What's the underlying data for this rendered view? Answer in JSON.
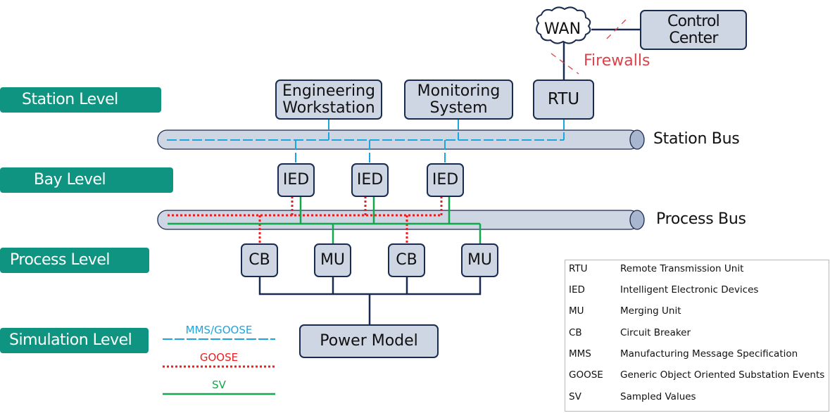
{
  "levels": [
    {
      "label": "Station Level"
    },
    {
      "label": "Bay Level"
    },
    {
      "label": "Process Level"
    },
    {
      "label": "Simulation Level"
    }
  ],
  "nodes": {
    "wan": "WAN",
    "control_center": "Control Center",
    "firewalls": "Firewalls",
    "engineering_workstation": "Engineering Workstation",
    "monitoring_system": "Monitoring System",
    "rtu": "RTU",
    "ied": [
      "IED",
      "IED",
      "IED"
    ],
    "process_devices": [
      "CB",
      "MU",
      "CB",
      "MU"
    ],
    "power_model": "Power Model"
  },
  "buses": {
    "station": "Station Bus",
    "process": "Process Bus"
  },
  "line_legend": [
    {
      "label": "MMS/GOOSE",
      "color": "#1aa6e0",
      "style": "dashed"
    },
    {
      "label": "GOOSE",
      "color": "#ee1c1c",
      "style": "dotted"
    },
    {
      "label": "SV",
      "color": "#10a84a",
      "style": "solid"
    }
  ],
  "abbreviations": [
    {
      "abbr": "RTU",
      "full": "Remote Transmission Unit"
    },
    {
      "abbr": "IED",
      "full": "Intelligent Electronic Devices"
    },
    {
      "abbr": "MU",
      "full": "Merging Unit"
    },
    {
      "abbr": "CB",
      "full": "Circuit Breaker"
    },
    {
      "abbr": "MMS",
      "full": "Manufacturing Message Specification"
    },
    {
      "abbr": "GOOSE",
      "full": "Generic Object Oriented Substation Events"
    },
    {
      "abbr": "SV",
      "full": "Sampled Values"
    }
  ],
  "colors": {
    "level_bg": "#0e9480",
    "box_fill": "#ced5e3",
    "box_border": "#1a2b50",
    "firewall": "#d9434a"
  }
}
